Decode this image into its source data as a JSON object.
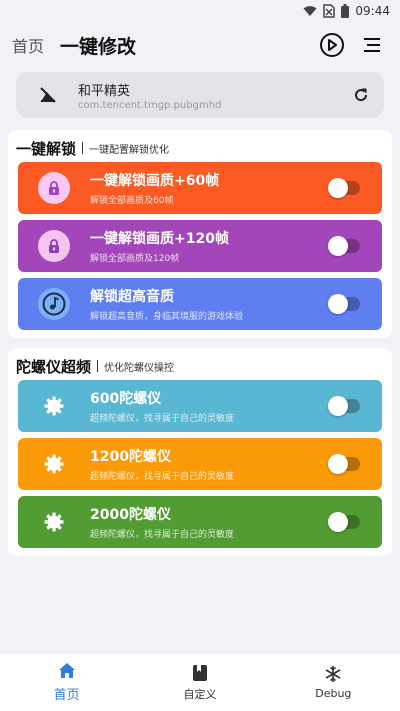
{
  "status_bar": {
    "time": "09:44"
  },
  "header": {
    "home_label": "首页",
    "title": "一键修改"
  },
  "game": {
    "name": "和平精英",
    "package": "com.tencent.tmgp.pubgmhd"
  },
  "sections": [
    {
      "title": "一键解锁",
      "subtitle": "一键配置解锁优化",
      "items": [
        {
          "title": "一键解锁画质+60帧",
          "desc": "解锁全部画质及60帧",
          "color": "#fb5a24",
          "icon_bg": "#f7c8f0",
          "icon_color": "#9b46c8",
          "icon": "lock-icon",
          "enabled": false
        },
        {
          "title": "一键解锁画质+120帧",
          "desc": "解锁全部画质及120帧",
          "color": "#a346b9",
          "icon_bg": "#f3c4ee",
          "icon_color": "#8e3fb5",
          "icon": "lock-icon",
          "enabled": false
        },
        {
          "title": "解锁超高音质",
          "desc": "解锁超高音质，身临其境服的游戏体验",
          "color": "#5f7ff1",
          "icon_bg": "#7bb0f2",
          "icon_color": "#1e2a55",
          "icon": "music-disc-icon",
          "enabled": false
        }
      ]
    },
    {
      "title": "陀螺仪超频",
      "subtitle": "优化陀螺仪操控",
      "items": [
        {
          "title": "600陀螺仪",
          "desc": "超频陀螺仪，找寻属于自己的灵敏度",
          "color": "#5ab7d4",
          "icon_bg": "#5ab7d4",
          "icon_color": "#ffffff",
          "icon": "gear-icon",
          "enabled": false
        },
        {
          "title": "1200陀螺仪",
          "desc": "超频陀螺仪，找寻属于自己的灵敏度",
          "color": "#fb9a08",
          "icon_bg": "#fb9a08",
          "icon_color": "#ffffff",
          "icon": "gear-icon",
          "enabled": false
        },
        {
          "title": "2000陀螺仪",
          "desc": "超频陀螺仪，找寻属于自己的灵敏度",
          "color": "#529c34",
          "icon_bg": "#529c34",
          "icon_color": "#ffffff",
          "icon": "gear-icon",
          "enabled": false
        }
      ]
    }
  ],
  "bottom_nav": [
    {
      "label": "首页",
      "icon": "home-icon",
      "active": true
    },
    {
      "label": "自定义",
      "icon": "book-icon",
      "active": false
    },
    {
      "label": "Debug",
      "icon": "snowflake-icon",
      "active": false
    }
  ],
  "colors": {
    "accent": "#2f7de1"
  }
}
